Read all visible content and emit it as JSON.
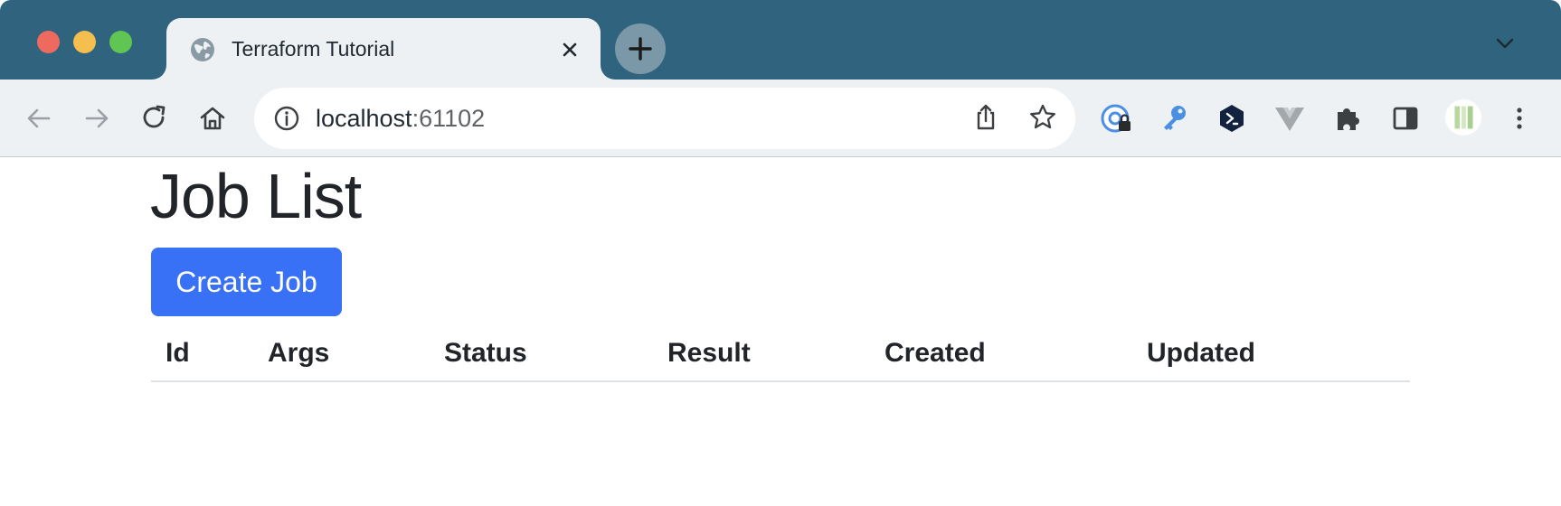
{
  "browser": {
    "tab": {
      "title": "Terraform Tutorial"
    },
    "address_bar": {
      "host": "localhost",
      "port": ":61102"
    }
  },
  "page": {
    "title": "Job List",
    "create_button_label": "Create Job",
    "table": {
      "columns": [
        "Id",
        "Args",
        "Status",
        "Result",
        "Created",
        "Updated"
      ],
      "rows": []
    }
  }
}
